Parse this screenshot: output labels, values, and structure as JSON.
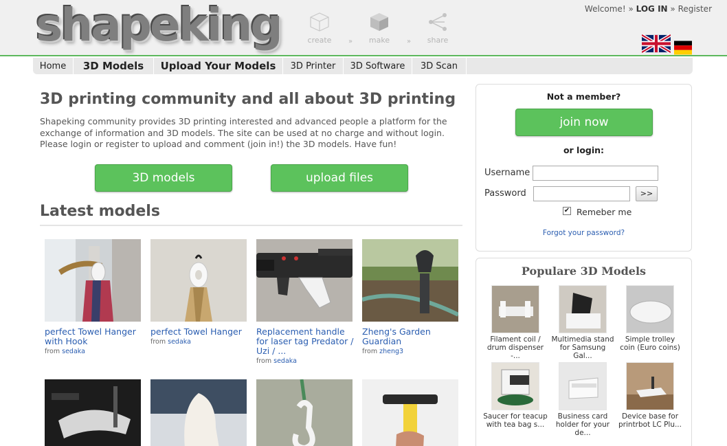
{
  "header": {
    "logo": "shapeking",
    "steps": [
      {
        "label": "create",
        "icon": "cube-outline-icon"
      },
      {
        "label": "make",
        "icon": "cube-solid-icon"
      },
      {
        "label": "share",
        "icon": "share-icon"
      }
    ],
    "step_separator": "»",
    "welcome": "Welcome!",
    "sep": "»",
    "login": "LOG IN",
    "register": "Register",
    "flags": [
      "uk-flag-icon",
      "german-flag-icon"
    ]
  },
  "nav": {
    "items": [
      {
        "label": "Home"
      },
      {
        "label": "3D Models"
      },
      {
        "label": "Upload Your Models"
      },
      {
        "label": "3D Printer"
      },
      {
        "label": "3D Software"
      },
      {
        "label": "3D Scan"
      }
    ]
  },
  "main": {
    "title": "3D printing community and all about 3D printing",
    "intro": "Shapeking community provides 3D printing interested and advanced people a platform for the exchange of information and 3D models. The site can be used at no charge and without login. Please login or register to upload and comment (join in!) the 3D models. Have fun!",
    "btn_models": "3D models",
    "btn_upload": "upload files",
    "latest_title": "Latest models",
    "from_label": "from",
    "models": [
      {
        "title": "perfect Towel Hanger with Hook",
        "user": "sedaka"
      },
      {
        "title": "perfect Towel Hanger",
        "user": "sedaka"
      },
      {
        "title": "Replacement handle for laser tag Predator / Uzi / ...",
        "user": "sedaka"
      },
      {
        "title": "Zheng's Garden Guardian",
        "user": "zheng3"
      }
    ]
  },
  "login": {
    "not_member": "Not a member?",
    "join": "join now",
    "or_login": "or login:",
    "username_label": "Username",
    "password_label": "Password",
    "go": ">>",
    "remember": "Remeber me",
    "forgot": "Forgot your password?"
  },
  "popular": {
    "title": "Populare 3D Models",
    "items": [
      {
        "title": "Filament coil / drum dispenser -..."
      },
      {
        "title": "Multimedia stand for Samsung Gal..."
      },
      {
        "title": "Simple trolley coin (Euro coins)"
      },
      {
        "title": "Saucer for teacup with tea bag s..."
      },
      {
        "title": "Business card holder for your de..."
      },
      {
        "title": "Device base for printrbot LC Plu..."
      }
    ]
  },
  "colors": {
    "accent": "#5cc25c",
    "link": "#2a5db0",
    "header_bg": "#f0f0f0"
  }
}
